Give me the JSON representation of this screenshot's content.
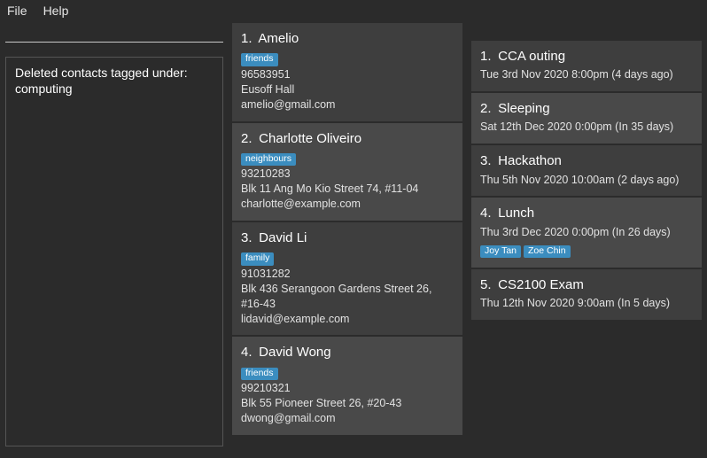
{
  "menu": {
    "file": "File",
    "help": "Help"
  },
  "command_input": {
    "value": ""
  },
  "result_message": {
    "line1": "Deleted contacts tagged under:",
    "line2": "computing"
  },
  "contacts": [
    {
      "index": "1.",
      "name": "Amelio",
      "tag": "friends",
      "tag_kind": "friends",
      "phone": "96583951",
      "address": "Eusoff Hall",
      "email": "amelio@gmail.com",
      "shade": "a"
    },
    {
      "index": "2.",
      "name": "Charlotte Oliveiro",
      "tag": "neighbours",
      "tag_kind": "neighbours",
      "phone": "93210283",
      "address": "Blk 11 Ang Mo Kio Street 74, #11-04",
      "email": "charlotte@example.com",
      "shade": "b"
    },
    {
      "index": "3.",
      "name": "David Li",
      "tag": "family",
      "tag_kind": "family",
      "phone": "91031282",
      "address": "Blk 436 Serangoon Gardens Street 26, #16-43",
      "email": "lidavid@example.com",
      "shade": "a"
    },
    {
      "index": "4.",
      "name": "David Wong",
      "tag": "friends",
      "tag_kind": "friends",
      "phone": "99210321",
      "address": "Blk 55 Pioneer Street 26, #20-43",
      "email": "dwong@gmail.com",
      "shade": "b"
    }
  ],
  "events": [
    {
      "index": "1.",
      "title": "CCA outing",
      "time": "Tue 3rd Nov 2020 8:00pm (4 days ago)",
      "people": [],
      "shade": "a"
    },
    {
      "index": "2.",
      "title": "Sleeping",
      "time": "Sat 12th Dec 2020 0:00pm (In 35 days)",
      "people": [],
      "shade": "b"
    },
    {
      "index": "3.",
      "title": "Hackathon",
      "time": "Thu 5th Nov 2020 10:00am (2 days ago)",
      "people": [],
      "shade": "a"
    },
    {
      "index": "4.",
      "title": "Lunch",
      "time": "Thu 3rd Dec 2020 0:00pm (In 26 days)",
      "people": [
        "Joy Tan",
        "Zoe Chin"
      ],
      "shade": "b"
    },
    {
      "index": "5.",
      "title": "CS2100 Exam",
      "time": "Thu 12th Nov 2020 9:00am (In 5 days)",
      "people": [],
      "shade": "a"
    }
  ]
}
